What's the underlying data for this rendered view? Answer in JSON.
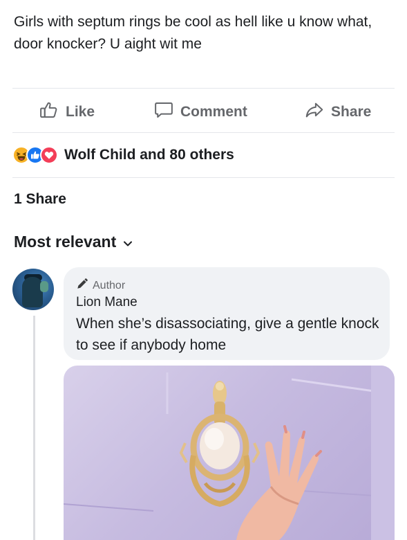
{
  "post": {
    "text": "Girls with septum rings be cool as hell like u know what, door knocker? U aight wit me"
  },
  "actions": {
    "like_label": "Like",
    "comment_label": "Comment",
    "share_label": "Share"
  },
  "reactions": {
    "icons": [
      "haha-icon",
      "like-icon",
      "love-icon"
    ],
    "summary": "Wolf Child and 80 others"
  },
  "shares": {
    "count_label": "1 Share"
  },
  "comments": {
    "sort_label": "Most relevant",
    "items": [
      {
        "badge": "Author",
        "name": "Lion Mane",
        "text": "When she’s disassociating, give a gentle knock to see if anybody home",
        "has_image": true
      }
    ]
  },
  "colors": {
    "text_primary": "#1c1e21",
    "text_secondary": "#65676b",
    "divider": "#e4e6eb",
    "bubble_bg": "#f0f2f5",
    "like_blue": "#1877f2",
    "love_red": "#f33e58",
    "haha_yellow": "#f7b125"
  }
}
